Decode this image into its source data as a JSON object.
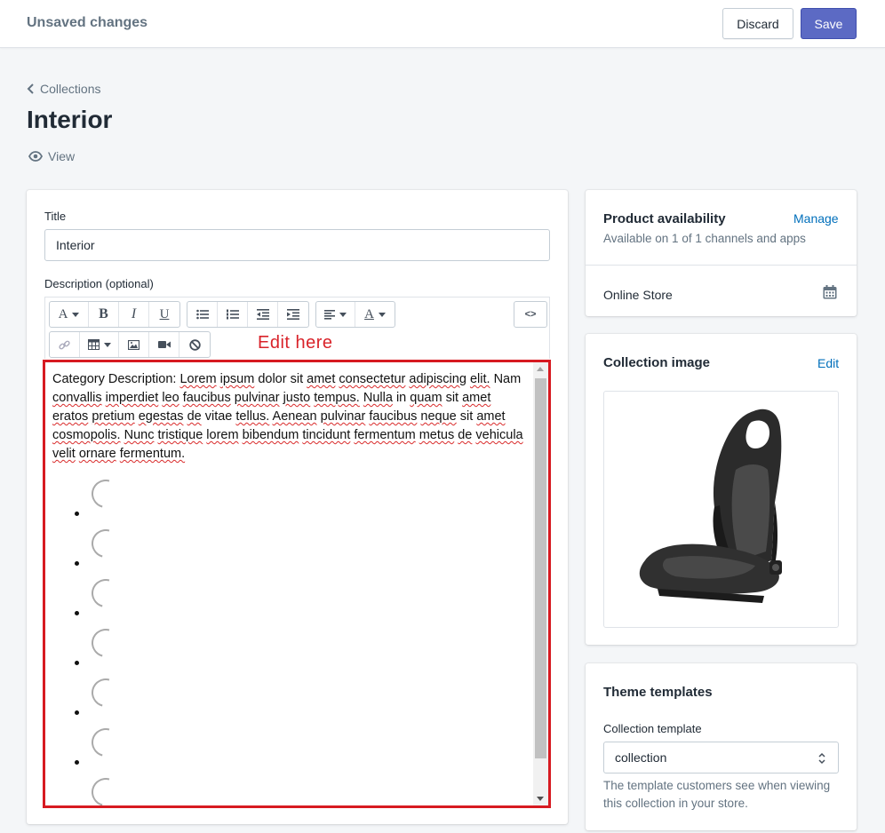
{
  "topbar": {
    "title": "Unsaved changes",
    "discard_label": "Discard",
    "save_label": "Save"
  },
  "header": {
    "breadcrumb": "Collections",
    "title": "Interior",
    "view_label": "View"
  },
  "main": {
    "title_label": "Title",
    "title_value": "Interior",
    "description_label": "Description (optional)",
    "toolbar": {
      "font_label": "A",
      "bold_label": "B",
      "italic_label": "I",
      "underline_label": "U",
      "color_label": "A",
      "html_label": "<>"
    },
    "annotation": "Edit here",
    "description_words": [
      "Category",
      "Description:",
      "Lorem",
      "ipsum",
      "dolor",
      "sit",
      "amet",
      "consectetur",
      "adipiscing",
      "elit.",
      "Nam",
      "convallis",
      "imperdiet",
      "leo",
      "faucibus",
      "pulvinar",
      "justo",
      "tempus.",
      "Nulla",
      "in",
      "quam",
      "sit",
      "amet",
      "eratos",
      "pretium",
      "egestas",
      "de",
      "vitae",
      "tellus.",
      "Aenean",
      "pulvinar",
      "faucibus",
      "neque",
      "sit",
      "amet",
      "cosmopolis.",
      "Nunc",
      "tristique",
      "lorem",
      "bibendum",
      "tincidunt",
      "fermentum",
      "metus",
      "de",
      "vehicula",
      "velit",
      "ornare",
      "fermentum."
    ],
    "misspelled_indices": [
      2,
      3,
      6,
      7,
      8,
      9,
      11,
      12,
      13,
      14,
      15,
      16,
      17,
      18,
      20,
      22,
      23,
      24,
      25,
      26,
      28,
      29,
      30,
      31,
      32,
      34,
      35,
      36,
      37,
      38,
      39,
      40,
      41,
      42,
      43,
      44,
      45,
      46,
      47
    ]
  },
  "availability": {
    "title": "Product availability",
    "manage_label": "Manage",
    "summary": "Available on 1 of 1 channels and apps",
    "channel": "Online Store"
  },
  "collection_image": {
    "title": "Collection image",
    "edit_label": "Edit"
  },
  "theme": {
    "title": "Theme templates",
    "template_label": "Collection template",
    "template_value": "collection",
    "help_line1": "The template customers see when viewing",
    "help_line2": "this collection in your store."
  },
  "colors": {
    "accent": "#5c6ac4",
    "link": "#006fbb",
    "annotation_red": "#d71a21"
  }
}
